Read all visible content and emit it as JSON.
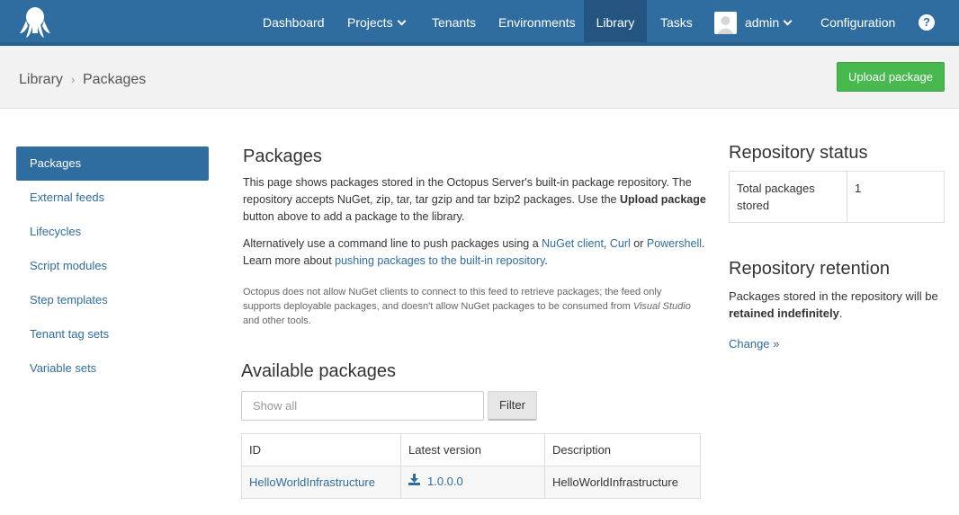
{
  "nav": {
    "items": [
      {
        "label": "Dashboard"
      },
      {
        "label": "Projects"
      },
      {
        "label": "Tenants"
      },
      {
        "label": "Environments"
      },
      {
        "label": "Library"
      },
      {
        "label": "Tasks"
      },
      {
        "label": "admin"
      },
      {
        "label": "Configuration"
      }
    ],
    "active": "Library",
    "help_label": "?"
  },
  "breadcrumb": {
    "items": [
      "Library",
      "Packages"
    ],
    "separator": "›"
  },
  "header": {
    "upload_label": "Upload package"
  },
  "sidebar": {
    "items": [
      {
        "label": "Packages"
      },
      {
        "label": "External feeds"
      },
      {
        "label": "Lifecycles"
      },
      {
        "label": "Script modules"
      },
      {
        "label": "Step templates"
      },
      {
        "label": "Tenant tag sets"
      },
      {
        "label": "Variable sets"
      }
    ],
    "active": "Packages"
  },
  "main": {
    "title": "Packages",
    "intro_1": "This page shows packages stored in the Octopus Server's built-in package repository. The repository accepts NuGet, zip, tar, tar gzip and tar bzip2 packages. Use the ",
    "intro_bold": "Upload package",
    "intro_2": " button above to add a package to the library.",
    "alt_1": "Alternatively use a command line to push packages using a ",
    "alt_link_nuget": "NuGet client",
    "alt_comma": ", ",
    "alt_link_curl": "Curl",
    "alt_or": " or ",
    "alt_link_ps": "Powershell",
    "alt_2": ". Learn more about ",
    "alt_link_push": "pushing packages to the built-in repository",
    "alt_3": ".",
    "note_1": "Octopus does not allow NuGet clients to connect to this feed to retrieve packages; the feed only supports deployable packages, and doesn't allow NuGet packages to be consumed from ",
    "note_italic": "Visual Studio",
    "note_2": " and other tools.",
    "available_title": "Available packages",
    "search_placeholder": "Show all",
    "search_value": "",
    "filter_label": "Filter",
    "table": {
      "headers": [
        "ID",
        "Latest version",
        "Description"
      ],
      "rows": [
        {
          "id": "HelloWorldInfrastructure",
          "version": "1.0.0.0",
          "description": "HelloWorldInfrastructure"
        }
      ]
    }
  },
  "right": {
    "status_title": "Repository status",
    "status_label": "Total packages stored",
    "status_value": "1",
    "retention_title": "Repository retention",
    "retention_1": "Packages stored in the repository will be ",
    "retention_bold": "retained indefinitely",
    "retention_2": ".",
    "change_label": "Change »"
  },
  "colors": {
    "nav": "#2f6da0",
    "nav_active": "#235580",
    "upload": "#48b94f",
    "link": "#2f6da0"
  },
  "icons": [
    "octopus-logo-icon",
    "chevron-down-icon",
    "avatar-icon",
    "help-icon",
    "download-icon"
  ]
}
